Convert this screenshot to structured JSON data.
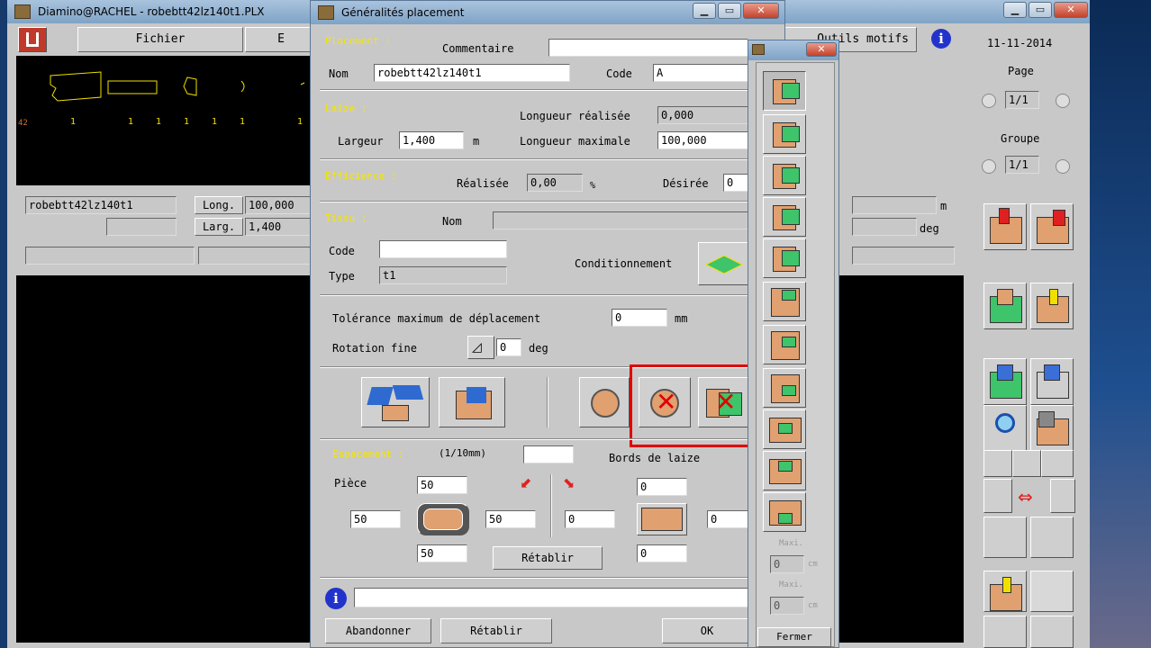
{
  "main_window": {
    "title": "Diamino@RACHEL - robebtt42lz140t1.PLX",
    "menu": {
      "fichier": "Fichier",
      "b": "E",
      "outils": "Outils motifs"
    },
    "date": "11-11-2014",
    "page_label": "Page",
    "page_value": "1/1",
    "groupe_label": "Groupe",
    "groupe_value": "1/1",
    "preview_numbers": [
      "42",
      "1",
      "1",
      "1",
      "1",
      "1",
      "1",
      "1"
    ],
    "info_name": "robebtt42lz140t1",
    "long_label": "Long.",
    "long_value": "100,000",
    "larg_label": "Larg.",
    "larg_value": "1,400",
    "unit_m": "m",
    "unit_deg": "deg"
  },
  "dialog": {
    "title": "Généralités placement",
    "sec_placement": "Placement :",
    "commentaire_label": "Commentaire",
    "nom_label": "Nom",
    "nom_value": "robebtt42lz140t1",
    "code_label": "Code",
    "code_value": "A",
    "sec_laize": "Laize :",
    "longueur_realisee_label": "Longueur réalisée",
    "longueur_realisee_value": "0,000",
    "largeur_label": "Largeur",
    "largeur_value": "1,400",
    "largeur_unit": "m",
    "longueur_max_label": "Longueur maximale",
    "longueur_max_value": "100,000",
    "sec_efficience": "Efficience :",
    "realisee_label": "Réalisée",
    "realisee_value": "0,00",
    "percent": "%",
    "desiree_label": "Désirée",
    "desiree_value": "0",
    "sec_tissu": "Tissu :",
    "tissu_nom_label": "Nom",
    "tissu_code_label": "Code",
    "type_label": "Type",
    "type_value": "t1",
    "conditionnement_label": "Conditionnement",
    "tolerance_label": "Tolérance maximum de déplacement",
    "tolerance_value": "0",
    "tolerance_unit": "mm",
    "rotation_label": "Rotation fine",
    "rotation_value": "0",
    "rotation_unit": "deg",
    "sec_espacement": "Espacement :",
    "espacement_unit": "(1/10mm)",
    "bords_label": "Bords de laize",
    "piece_label": "Pièce",
    "piece_top": "50",
    "piece_left": "50",
    "piece_right": "50",
    "piece_bottom": "50",
    "bord_top": "0",
    "bord_left": "0",
    "bord_right": "0",
    "bord_bottom": "0",
    "retablir_small": "Rétablir",
    "abandonner": "Abandonner",
    "retablir": "Rétablir",
    "ok": "OK"
  },
  "tools_panel": {
    "maxi_label": "Maxi.",
    "maxi_value": "0",
    "maxi_unit": "cm",
    "maxi2_label": "Maxi.",
    "maxi2_value": "0",
    "maxi2_unit": "cm",
    "fermer": "Fermer"
  },
  "colors": {
    "highlight": "#e00000",
    "section": "#f5e600",
    "piece": "#e0a070",
    "green": "#3ec46b"
  }
}
